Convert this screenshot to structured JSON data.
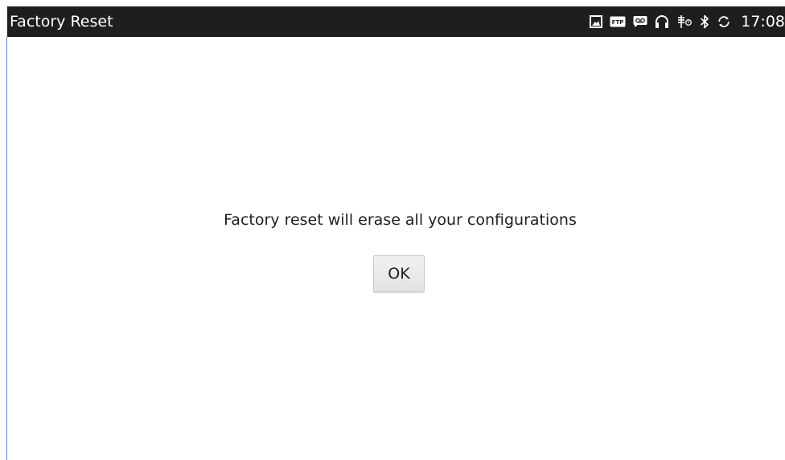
{
  "status_bar": {
    "title": "Factory Reset",
    "time": "17:08",
    "icons": [
      "image-icon",
      "ftp-icon",
      "voicemail-icon",
      "headset-icon",
      "usb-debug-icon",
      "bluetooth-icon",
      "sync-icon"
    ],
    "ftp_label": "FTP"
  },
  "dialog": {
    "message": "Factory reset will erase all your configurations",
    "ok_label": "OK"
  },
  "colors": {
    "status_bar_bg": "#1e1e1e",
    "status_text": "#ffffff",
    "content_bg": "#ffffff",
    "button_bg": "#e9e9e9"
  }
}
